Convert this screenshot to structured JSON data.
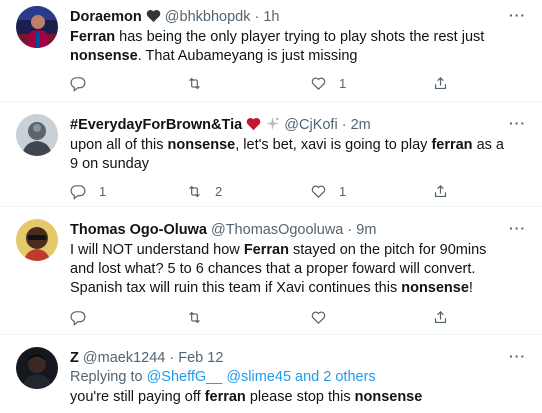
{
  "tweets": [
    {
      "name": "Doraemon",
      "handle": "@bhkbhopdk",
      "time": "1h",
      "text_parts": [
        "",
        "Ferran",
        " has being the only player trying to play shots the rest just ",
        "nonsense",
        ". That Aubameyang is just missing"
      ],
      "replies": "",
      "retweets": "",
      "likes": "1",
      "more": "···"
    },
    {
      "name": "#EverydayForBrown&Tia",
      "handle": "@CjKofi",
      "time": "2m",
      "text_parts": [
        "upon all of this ",
        "nonsense",
        ", let's bet, xavi is going to play ",
        "ferran",
        " as a 9 on sunday"
      ],
      "replies": "1",
      "retweets": "2",
      "likes": "1",
      "more": "···"
    },
    {
      "name": "Thomas Ogo-Oluwa",
      "handle": "@ThomasOgooluwa",
      "time": "9m",
      "text_parts": [
        "I will NOT understand how ",
        "Ferran",
        " stayed on the pitch for 90mins and lost what? 5 to 6 chances that a proper foward will convert. Spanish tax will ruin this team if Xavi continues this ",
        "nonsense",
        "!"
      ],
      "replies": "",
      "retweets": "",
      "likes": "",
      "more": "···"
    },
    {
      "name": "Z",
      "handle": "@maek1244",
      "time": "Feb 12",
      "replying_label": "Replying to",
      "replying_users": "@SheffG__ @slime45 and 2 others",
      "text_parts": [
        "you're still paying off ",
        "ferran",
        " please stop this ",
        "nonsense",
        ""
      ],
      "more": "···"
    }
  ],
  "dot": "·",
  "colors": {
    "link": "#1d9bf0",
    "secondary_text": "#536471",
    "divider": "#eff3f4",
    "heart_red": "#be1931"
  },
  "icons": [
    "reply-icon",
    "retweet-icon",
    "like-icon",
    "share-icon",
    "more-icon",
    "black-heart-icon",
    "red-heart-icon",
    "sparkle-icon"
  ]
}
